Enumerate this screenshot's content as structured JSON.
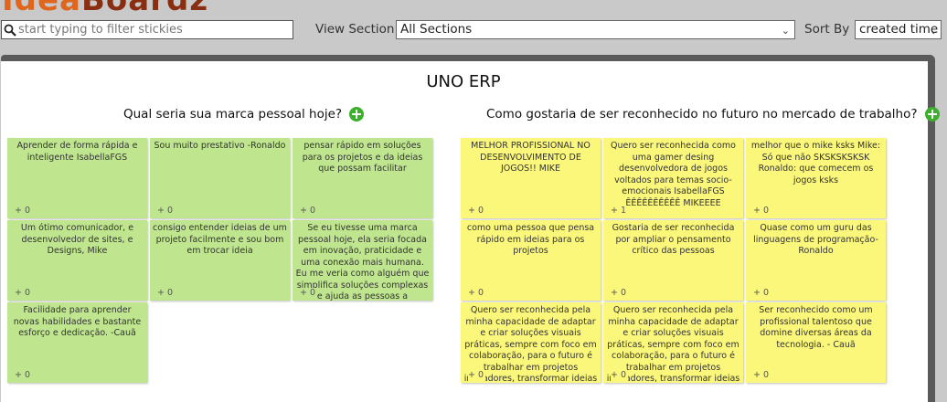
{
  "app": {
    "logo_part1": "Idea",
    "logo_part2": "Boardz"
  },
  "toolbar": {
    "search_placeholder": "start typing to filter stickies",
    "view_section_label": "View Section",
    "view_section_value": "All Sections",
    "sort_label": "Sort By",
    "sort_value": "created time"
  },
  "board": {
    "title": "UNO ERP",
    "sections": [
      {
        "title": "Qual seria sua marca pessoal hoje?",
        "color": "#bfe68f",
        "stickies": [
          {
            "text": "Aprender de forma rápida e inteligente IsabellaFGS",
            "votes": "+ 0"
          },
          {
            "text": "Sou muito prestativo -Ronaldo",
            "votes": "+ 0"
          },
          {
            "text": "pensar rápido em soluções para os projetos e da ideias que possam facilitar",
            "votes": "+ 0"
          },
          {
            "text": "Um ótimo comunicador, e desenvolvedor de sites, e Designs, Mike",
            "votes": "+ 0"
          },
          {
            "text": "consigo entender ideias de um projeto facilmente e sou bom em trocar ideia",
            "votes": "+ 0"
          },
          {
            "text": "Se eu tivesse uma marca pessoal hoje, ela seria focada em inovação, praticidade e uma conexão mais humana. Eu me veria como alguém que simplifica soluções complexas e ajuda as pessoas a resolverem problemas",
            "votes": "+ 0"
          },
          {
            "text": "Facilidade para aprender novas habilidades e bastante esforço e dedicação. -Cauã",
            "votes": "+ 0"
          }
        ]
      },
      {
        "title": "Como gostaria de ser reconhecido no futuro no mercado de trabalho?",
        "color": "#fbf77b",
        "stickies": [
          {
            "text": "MELHOR PROFISSIONAL NO DESENVOLVIMENTO DE JOGOS!! MIKE",
            "votes": "+ 0"
          },
          {
            "text": "Quero ser reconhecida como uma gamer desing desenvolvedora de jogos voltados para temas socio-emocionais IsabellaFGS ÊÊÊÊÊÊÊÊÊÊ MIKEEEE",
            "votes": "+ 1"
          },
          {
            "text": "melhor que o mike ksks Mike: Só que não SKSKSKSKSK Ronaldo: que comecem os jogos ksks",
            "votes": "+ 0"
          },
          {
            "text": "como uma pessoa que pensa rápido em ideias para os projetos",
            "votes": "+ 0"
          },
          {
            "text": "Gostaria de ser reconhecida por ampliar o pensamento crítico das pessoas",
            "votes": "+ 0"
          },
          {
            "text": "Quase como um guru das linguagens de programação-Ronaldo",
            "votes": "+ 0"
          },
          {
            "text": "Quero ser reconhecida pela minha capacidade de adaptar e criar soluções visuais práticas, sempre com foco em colaboração, para o futuro é trabalhar em projetos inovadores, transformar ideias",
            "votes": "+ 0"
          },
          {
            "text": "Quero ser reconhecida pela minha capacidade de adaptar e criar soluções visuais práticas, sempre com foco em colaboração, para o futuro é trabalhar em projetos inovadores, transformar ideias",
            "votes": "+ 0"
          },
          {
            "text": "Ser reconhecido como um profissional talentoso que domine diversas áreas da tecnologia. - Cauã",
            "votes": "+ 0"
          }
        ]
      }
    ]
  }
}
